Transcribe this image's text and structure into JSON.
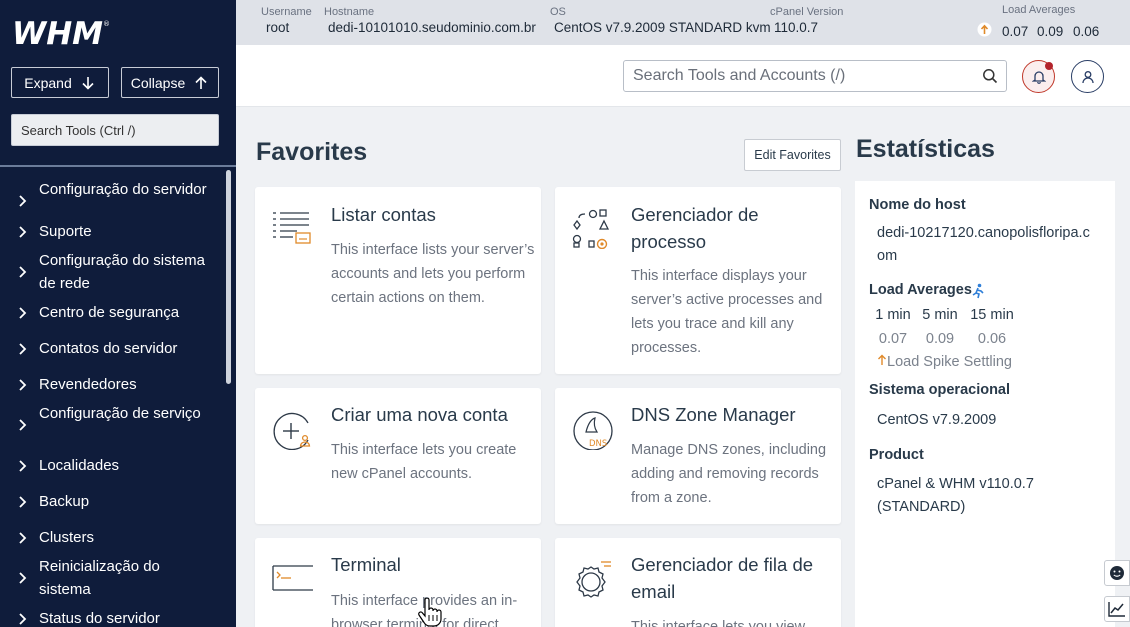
{
  "sidebar": {
    "logo_text": "WHM",
    "expand_label": "Expand",
    "collapse_label": "Collapse",
    "search_placeholder": "Search Tools (Ctrl /)",
    "items": [
      {
        "label": "Configuração do servidor"
      },
      {
        "label": "Suporte"
      },
      {
        "label": "Configuração do sistema de rede"
      },
      {
        "label": "Centro de segurança"
      },
      {
        "label": "Contatos do servidor"
      },
      {
        "label": "Revendedores"
      },
      {
        "label": "Configuração de serviço"
      },
      {
        "label": "Localidades"
      },
      {
        "label": "Backup"
      },
      {
        "label": "Clusters"
      },
      {
        "label": "Reinicialização do sistema"
      },
      {
        "label": "Status do servidor"
      }
    ]
  },
  "topbar": {
    "username_label": "Username",
    "username": "root",
    "hostname_label": "Hostname",
    "hostname": "dedi-10101010.seudominio.com.br",
    "os_label": "OS",
    "os": "CentOS v7.9.2009 STANDARD kvm",
    "cpanel_label": "cPanel Version",
    "cpanel_version": "110.0.7",
    "load_label": "Load Averages",
    "load_1": "0.07",
    "load_5": "0.09",
    "load_15": "0.06"
  },
  "header": {
    "search_placeholder": "Search Tools and Accounts (/)"
  },
  "favorites": {
    "title": "Favorites",
    "edit_label": "Edit Favorites",
    "cards": [
      {
        "title": "Listar contas",
        "desc": "This interface lists your server’s accounts and lets you perform certain actions on them.",
        "icon": "list-accounts-icon"
      },
      {
        "title": "Gerenciador de processo",
        "desc": "This interface displays your server’s active processes and lets you trace and kill any processes.",
        "icon": "process-manager-icon"
      },
      {
        "title": "Criar uma nova conta",
        "desc": "This interface lets you create new cPanel accounts.",
        "icon": "add-account-icon"
      },
      {
        "title": "DNS Zone Manager",
        "desc": "Manage DNS zones, including adding and removing records from a zone.",
        "icon": "dns-icon"
      },
      {
        "title": "Terminal",
        "desc": "This interface provides an in-browser terminal for direct",
        "icon": "terminal-icon"
      },
      {
        "title": "Gerenciador de fila de email",
        "desc": "This interface lets you view",
        "icon": "mail-queue-icon"
      }
    ]
  },
  "stats": {
    "title": "Estatísticas",
    "host_label": "Nome do host",
    "host_value": "dedi-10217120.canopolisfloripa.com",
    "load_label": "Load Averages",
    "col_1": "1 min",
    "col_5": "5 min",
    "col_15": "15 min",
    "val_1": "0.07",
    "val_5": "0.09",
    "val_15": "0.06",
    "spike_text": "Load Spike Settling",
    "os_label": "Sistema operacional",
    "os_value": "CentOS v7.9.2009",
    "product_label": "Product",
    "product_value": "cPanel & WHM v110.0.7 (STANDARD)"
  },
  "colors": {
    "sidebar_bg": "#0f1c3b",
    "topbar_bg": "#dfe2e8",
    "accent_orange": "#e08a2a",
    "alert_red": "#b3232b"
  }
}
